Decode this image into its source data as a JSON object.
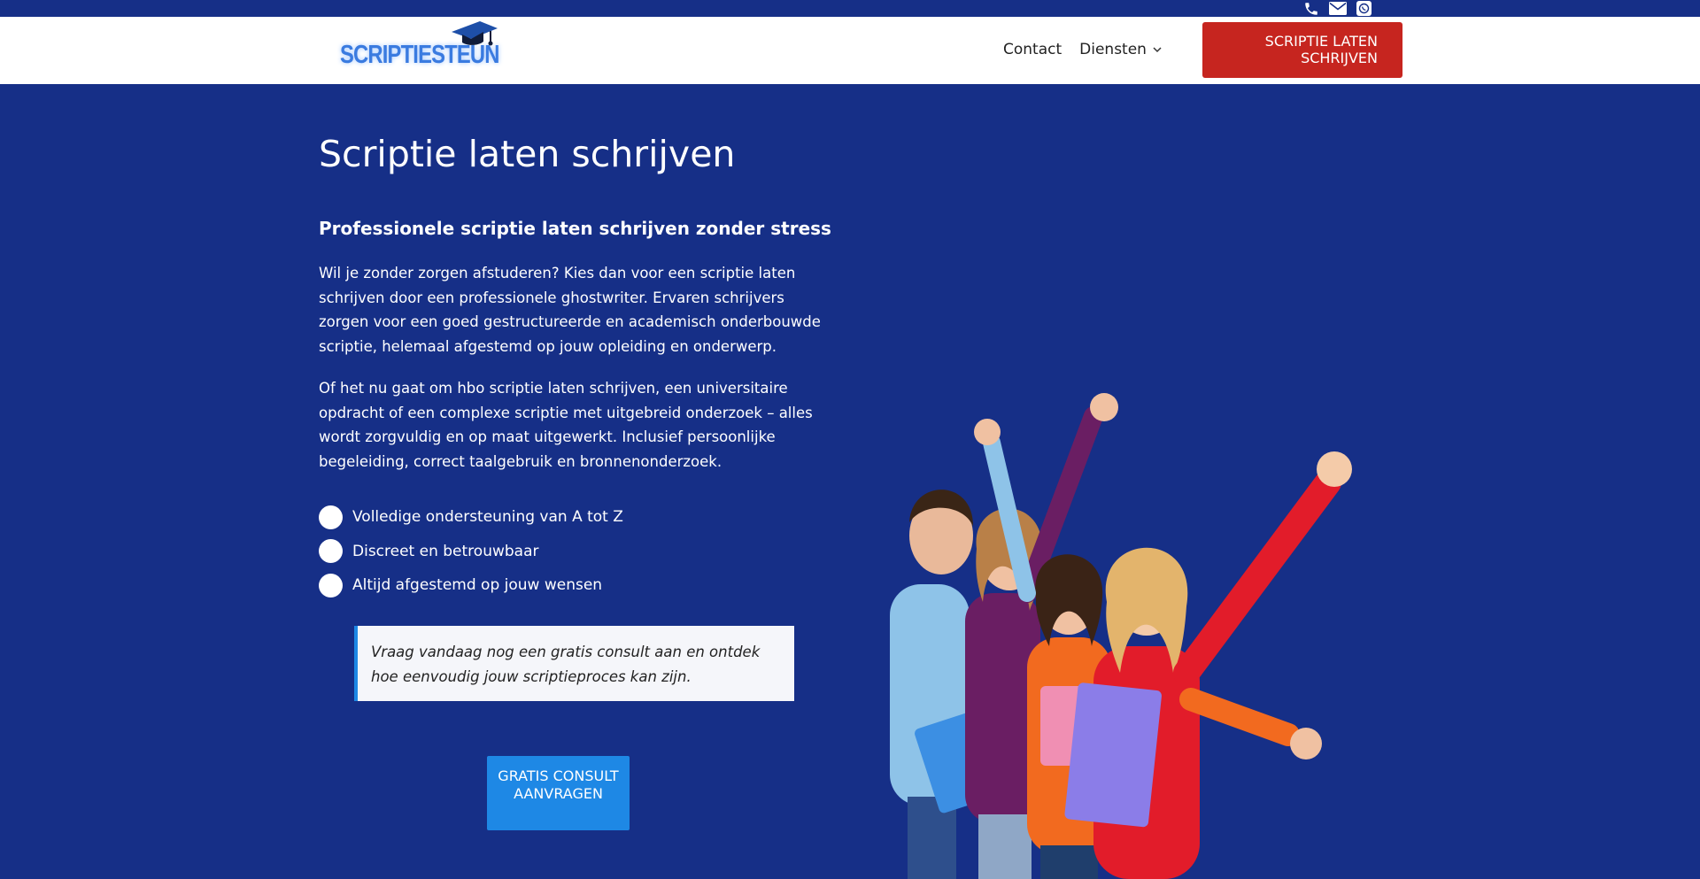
{
  "topbar": {
    "icons": [
      "phone-icon",
      "mail-icon",
      "whatsapp-icon"
    ]
  },
  "header": {
    "logo_text": "SCRIPTIESTEUN",
    "nav": {
      "contact": "Contact",
      "diensten": "Diensten"
    },
    "cta": "SCRIPTIE LATEN SCHRIJVEN"
  },
  "hero": {
    "title": "Scriptie laten schrijven",
    "subtitle": "Professionele scriptie laten schrijven zonder stress",
    "paragraph1": "Wil je zonder zorgen afstuderen? Kies dan voor een scriptie laten schrijven door een professionele ghostwriter. Ervaren schrijvers zorgen voor een goed gestructureerde en academisch onderbouwde scriptie, helemaal afgestemd op jouw opleiding en onderwerp.",
    "paragraph2": "Of het nu gaat om hbo scriptie laten schrijven, een universitaire opdracht of een complexe scriptie met uitgebreid onderzoek – alles wordt zorgvuldig en op maat uitgewerkt. Inclusief persoonlijke begeleiding, correct taalgebruik en bronnenonderzoek.",
    "checks": [
      "Volledige ondersteuning van A tot Z",
      "Discreet en betrouwbaar",
      "Altijd afgestemd op jouw wensen"
    ],
    "quote": "Vraag vandaag nog een gratis consult aan en ontdek hoe eenvoudig jouw scriptieproces kan zijn.",
    "cta": "GRATIS CONSULT AANVRAGEN"
  },
  "colors": {
    "background": "#162f87",
    "header_bg": "#ffffff",
    "cta_red": "#c6251f",
    "cta_blue": "#1e88e5",
    "quote_bg": "#f5f6fa"
  }
}
